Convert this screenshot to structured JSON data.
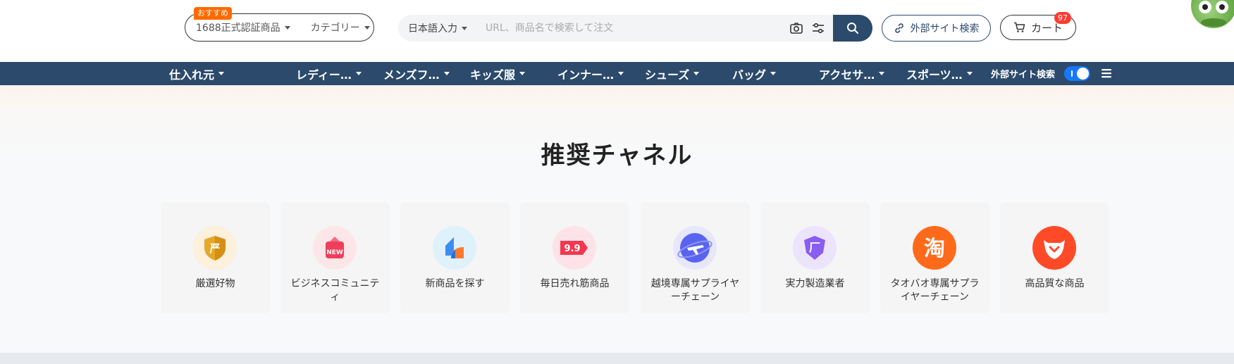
{
  "header": {
    "recommend_badge": "おすすめ",
    "site_select": "1688正式認証商品",
    "category_select": "カテゴリー",
    "search": {
      "language": "日本語入力",
      "placeholder": "URL、商品名で検索して注文",
      "camera_icon": "camera-icon",
      "filter_icon": "sliders-icon",
      "button_icon": "search-icon"
    },
    "external_search_label": "外部サイト検索",
    "cart": {
      "label": "カート",
      "badge": "97"
    }
  },
  "nav": {
    "items": [
      {
        "label": "仕入れ元"
      },
      {
        "label": "レディー…"
      },
      {
        "label": "メンズフ…"
      },
      {
        "label": "キッズ服"
      },
      {
        "label": "インナー…"
      },
      {
        "label": "シューズ"
      },
      {
        "label": "バッグ"
      },
      {
        "label": "アクセサ…"
      },
      {
        "label": "スポーツ…"
      }
    ],
    "external_search_label": "外部サイト検索",
    "external_search_enabled": true,
    "colors": {
      "bar": "#2c4a6b",
      "toggle": "#1677ff"
    }
  },
  "channels": {
    "title": "推奨チャネル",
    "items": [
      {
        "label": "厳選好物",
        "icon": "yan-shield-icon",
        "glyph": "严",
        "color": "#e5a82a"
      },
      {
        "label": "ビジネスコミュニティ",
        "icon": "new-gift-icon",
        "glyph": "NEW",
        "color": "#ef3e5a"
      },
      {
        "label": "新商品を探す",
        "icon": "new-product-icon",
        "glyph": "",
        "color": "#3b8ef0"
      },
      {
        "label": "毎日売れ筋商品",
        "icon": "price-tag-9-9-icon",
        "glyph": "9.9",
        "color": "#f2374f"
      },
      {
        "label": "越境専属サプライヤーチェーン",
        "icon": "airplane-icon",
        "glyph": "",
        "color": "#5a63f0"
      },
      {
        "label": "実力製造業者",
        "icon": "factory-gem-icon",
        "glyph": "厂",
        "color": "#8a5cf0"
      },
      {
        "label": "タオバオ専属サプライヤーチェーン",
        "icon": "taobao-icon",
        "glyph": "淘",
        "color": "#ff6a1a"
      },
      {
        "label": "高品質な商品",
        "icon": "tmall-cat-icon",
        "glyph": "",
        "color": "#ff4a28"
      }
    ]
  }
}
